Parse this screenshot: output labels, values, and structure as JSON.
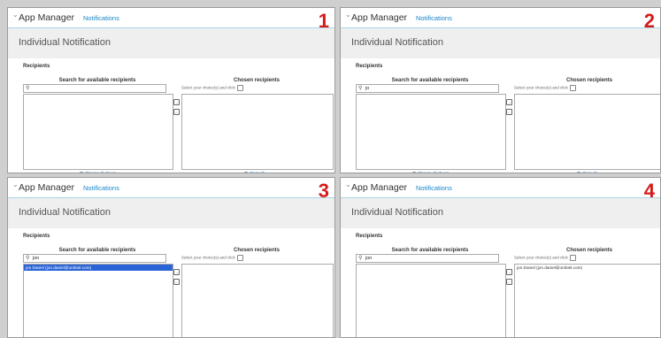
{
  "panels": [
    {
      "step": "1",
      "app_title": "App Manager",
      "breadcrumb": "Notifications",
      "page_title": "Individual Notification",
      "recipients_label": "Recipients",
      "available_heading": "Search for available recipients",
      "chosen_heading": "Chosen recipients",
      "chosen_hint": "Select your choice(s) and click",
      "search_value": "",
      "available_options": [],
      "chosen_options": [],
      "choose_all_label": "Choose all shown",
      "clear_all_label": "Clear all"
    },
    {
      "step": "2",
      "app_title": "App Manager",
      "breadcrumb": "Notifications",
      "page_title": "Individual Notification",
      "recipients_label": "Recipients",
      "available_heading": "Search for available recipients",
      "chosen_heading": "Chosen recipients",
      "chosen_hint": "Select your choice(s) and click",
      "search_value": "jo",
      "available_options": [],
      "chosen_options": [],
      "choose_all_label": "Choose all shown",
      "clear_all_label": "Clear all"
    },
    {
      "step": "3",
      "app_title": "App Manager",
      "breadcrumb": "Notifications",
      "page_title": "Individual Notification",
      "recipients_label": "Recipients",
      "available_heading": "Search for available recipients",
      "chosen_heading": "Chosen recipients",
      "chosen_hint": "Select your choice(s) and click",
      "search_value": "jon",
      "available_options": [
        {
          "label": "jon Daniel (jon.daniel@ombiel.com)",
          "selected": true
        }
      ],
      "chosen_options": [],
      "choose_all_label": "",
      "clear_all_label": ""
    },
    {
      "step": "4",
      "app_title": "App Manager",
      "breadcrumb": "Notifications",
      "page_title": "Individual Notification",
      "recipients_label": "Recipients",
      "available_heading": "Search for available recipients",
      "chosen_heading": "Chosen recipients",
      "chosen_hint": "Select your choice(s) and click",
      "search_value": "jon",
      "available_options": [],
      "chosen_options": [
        {
          "label": "jon Daniel (jon.daniel@ombiel.com)",
          "selected": false
        }
      ],
      "choose_all_label": "",
      "clear_all_label": ""
    }
  ]
}
